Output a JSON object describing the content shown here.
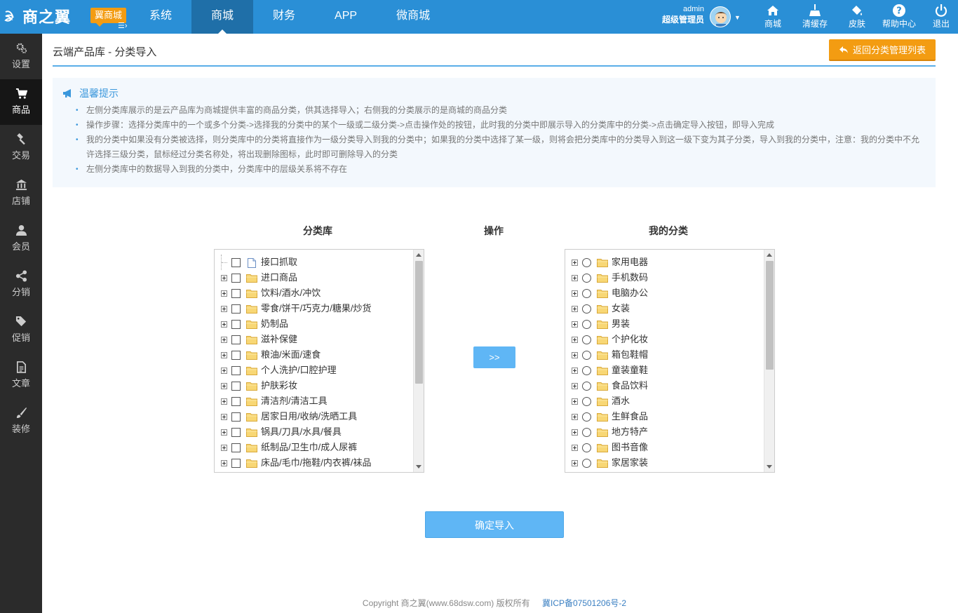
{
  "topbar": {
    "logo_text": "商之翼",
    "brand_badge": "翼商城",
    "nav": [
      {
        "label": "系统",
        "active": false
      },
      {
        "label": "商城",
        "active": true
      },
      {
        "label": "财务",
        "active": false
      },
      {
        "label": "APP",
        "active": false
      },
      {
        "label": "微商城",
        "active": false
      }
    ],
    "user": {
      "name": "admin",
      "role": "超级管理员"
    },
    "tools": [
      {
        "label": "商城",
        "icon": "home-icon"
      },
      {
        "label": "清缓存",
        "icon": "broom-icon"
      },
      {
        "label": "皮肤",
        "icon": "paint-bucket-icon"
      },
      {
        "label": "帮助中心",
        "icon": "help-icon"
      },
      {
        "label": "退出",
        "icon": "power-icon"
      }
    ]
  },
  "sidebar": {
    "items": [
      {
        "label": "设置",
        "icon": "gears-icon",
        "active": false
      },
      {
        "label": "商品",
        "icon": "cart-icon",
        "active": true
      },
      {
        "label": "交易",
        "icon": "gavel-icon",
        "active": false
      },
      {
        "label": "店铺",
        "icon": "bank-icon",
        "active": false
      },
      {
        "label": "会员",
        "icon": "user-icon",
        "active": false
      },
      {
        "label": "分销",
        "icon": "share-icon",
        "active": false
      },
      {
        "label": "促销",
        "icon": "tags-icon",
        "active": false
      },
      {
        "label": "文章",
        "icon": "document-icon",
        "active": false
      },
      {
        "label": "装修",
        "icon": "brush-icon",
        "active": false
      }
    ]
  },
  "page": {
    "title": "云端产品库 - 分类导入",
    "back_button": "返回分类管理列表"
  },
  "tips": {
    "title": "温馨提示",
    "items": [
      "左侧分类库展示的是云产品库为商城提供丰富的商品分类，供其选择导入；右侧我的分类展示的是商城的商品分类",
      "操作步骤：选择分类库中的一个或多个分类->选择我的分类中的某个一级或二级分类->点击操作处的按钮，此时我的分类中即展示导入的分类库中的分类->点击确定导入按钮，即导入完成",
      "我的分类中如果没有分类被选择，则分类库中的分类将直接作为一级分类导入到我的分类中；如果我的分类中选择了某一级，则将会把分类库中的分类导入到这一级下变为其子分类，导入到我的分类中，注意：我的分类中不允许选择三级分类，鼠标经过分类名称处，将出现删除图标，此时即可删除导入的分类",
      "左侧分类库中的数据导入到我的分类中，分类库中的层级关系将不存在"
    ]
  },
  "columns": {
    "library": "分类库",
    "action": "操作",
    "mine": "我的分类"
  },
  "library_items": [
    {
      "label": "接口抓取",
      "type": "leaf"
    },
    {
      "label": "进口商品",
      "type": "folder"
    },
    {
      "label": "饮料/酒水/冲饮",
      "type": "folder"
    },
    {
      "label": "零食/饼干/巧克力/糖果/炒货",
      "type": "folder"
    },
    {
      "label": "奶制品",
      "type": "folder"
    },
    {
      "label": "滋补保健",
      "type": "folder"
    },
    {
      "label": "粮油/米面/速食",
      "type": "folder"
    },
    {
      "label": "个人洗护/口腔护理",
      "type": "folder"
    },
    {
      "label": "护肤彩妆",
      "type": "folder"
    },
    {
      "label": "清洁剂/清洁工具",
      "type": "folder"
    },
    {
      "label": "居家日用/收纳/洗晒工具",
      "type": "folder"
    },
    {
      "label": "锅具/刀具/水具/餐具",
      "type": "folder"
    },
    {
      "label": "纸制品/卫生巾/成人尿裤",
      "type": "folder"
    },
    {
      "label": "床品/毛巾/拖鞋/内衣裤/袜品",
      "type": "folder"
    }
  ],
  "my_items": [
    {
      "label": "家用电器"
    },
    {
      "label": "手机数码"
    },
    {
      "label": "电脑办公"
    },
    {
      "label": "女装"
    },
    {
      "label": "男装"
    },
    {
      "label": "个护化妆"
    },
    {
      "label": "箱包鞋帽"
    },
    {
      "label": "童装童鞋"
    },
    {
      "label": "食品饮料"
    },
    {
      "label": "酒水"
    },
    {
      "label": "生鲜食品"
    },
    {
      "label": "地方特产"
    },
    {
      "label": "图书音像"
    },
    {
      "label": "家居家装"
    }
  ],
  "buttons": {
    "move": ">>",
    "confirm": "确定导入"
  },
  "footer": {
    "copyright": "Copyright 商之翼(www.68dsw.com) 版权所有",
    "icp": "冀ICP备07501206号-2"
  },
  "colors": {
    "topbar": "#2a8fd6",
    "accent_orange": "#f39c12",
    "button_blue": "#5fb6f5",
    "sidebar": "#2b2b2b"
  }
}
